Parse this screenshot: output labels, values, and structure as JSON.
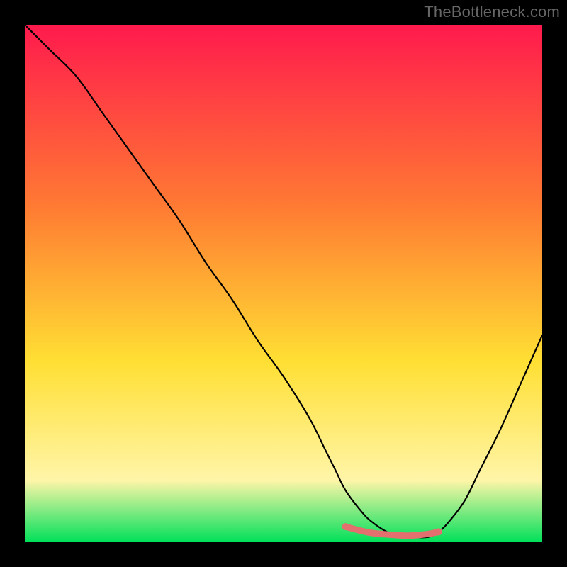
{
  "watermark": "TheBottleneck.com",
  "colors": {
    "frame": "#000000",
    "gradient_top": "#ff1a4d",
    "gradient_mid1": "#ff7a33",
    "gradient_mid2": "#ffdf33",
    "gradient_low": "#fff5a8",
    "gradient_bottom": "#00e05a",
    "curve": "#000000",
    "highlight": "#e46f6f"
  },
  "chart_data": {
    "type": "line",
    "title": "",
    "xlabel": "",
    "ylabel": "",
    "xlim": [
      0,
      100
    ],
    "ylim": [
      0,
      100
    ],
    "x": [
      0,
      3,
      5,
      10,
      15,
      20,
      25,
      30,
      35,
      40,
      45,
      50,
      55,
      58,
      60,
      62,
      65,
      67,
      70,
      73,
      75,
      78,
      80,
      82,
      85,
      88,
      92,
      96,
      100
    ],
    "y": [
      100,
      97,
      95,
      90,
      83,
      76,
      69,
      62,
      54,
      47,
      39,
      32,
      24,
      18,
      14,
      10,
      6,
      4,
      2,
      1,
      1,
      1,
      2,
      4,
      8,
      14,
      22,
      31,
      40
    ],
    "highlight_segment": {
      "x": [
        62,
        65,
        67,
        70,
        73,
        75,
        78,
        80
      ],
      "y": [
        3,
        2.2,
        1.8,
        1.5,
        1.3,
        1.3,
        1.6,
        2
      ]
    }
  }
}
